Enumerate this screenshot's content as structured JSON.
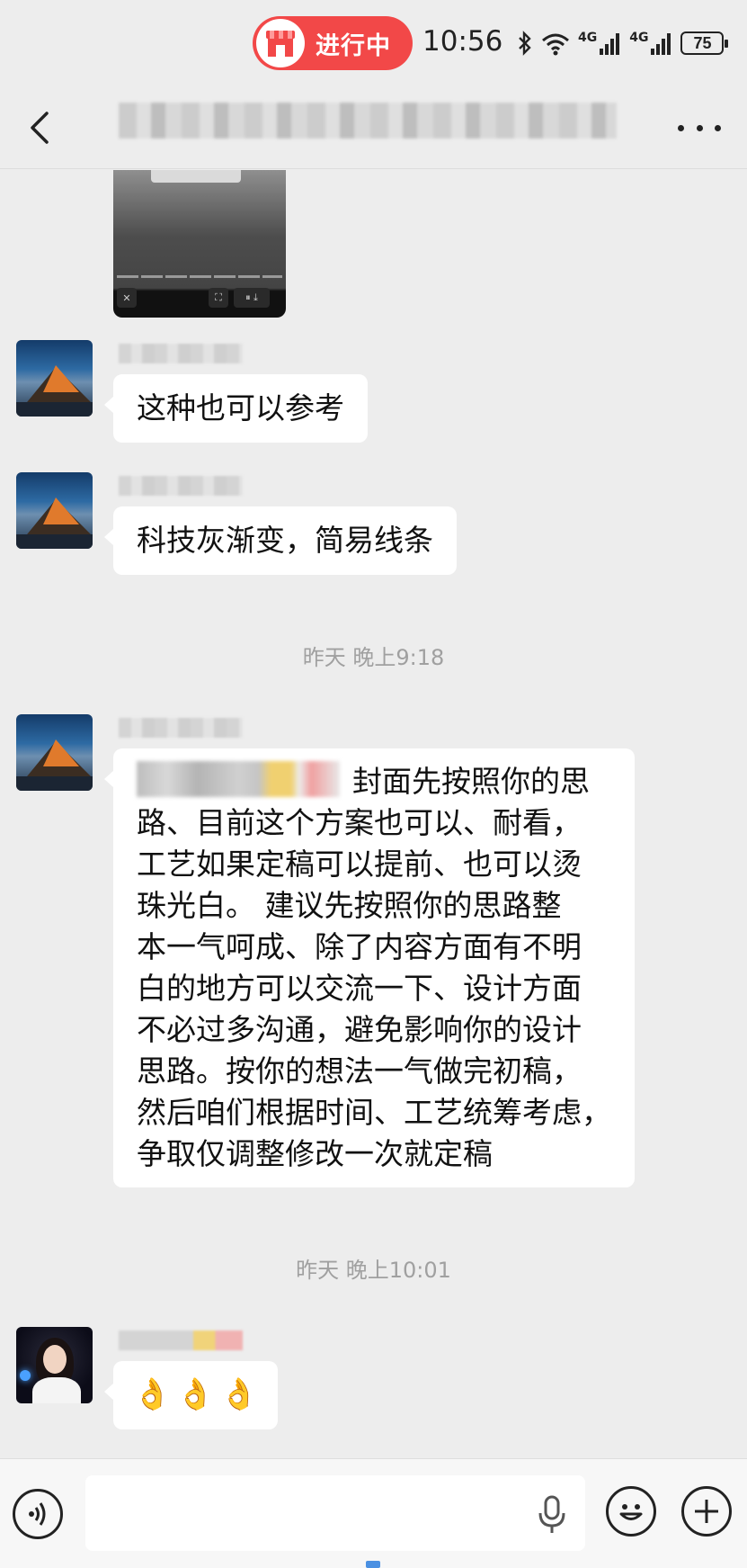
{
  "status_bar": {
    "pill_label": "进行中",
    "time": "10:56",
    "network_1": "4G",
    "network_2": "4G",
    "battery": "75"
  },
  "nav": {
    "back_icon": "chevron-left-icon",
    "more_icon": "more-dots-icon"
  },
  "messages": [
    {
      "type": "text",
      "text": "这种也可以参考"
    },
    {
      "type": "text",
      "text": "科技灰渐变，简易线条"
    },
    {
      "type": "timestamp",
      "text": "昨天 晚上9:18"
    },
    {
      "type": "text",
      "lines": [
        "封面先按照你的思",
        "路、目前这个方案也可以、耐看，",
        "工艺如果定稿可以提前、也可以烫",
        "珠光白。  建议先按照你的思路整",
        "本一气呵成、除了内容方面有不明",
        "白的地方可以交流一下、设计方面",
        "不必过多沟通，避免影响你的设计",
        "思路。按你的想法一气做完初稿，",
        "然后咱们根据时间、工艺统筹考虑，",
        "争取仅调整修改一次就定稿"
      ]
    },
    {
      "type": "timestamp",
      "text": "昨天 晚上10:01"
    },
    {
      "type": "emoji",
      "emojis": [
        "👌",
        "👌",
        "👌"
      ]
    }
  ],
  "input_bar": {
    "voice_icon": "voice-icon",
    "mic_icon": "microphone-icon",
    "emoji_icon": "emoji-icon",
    "plus_icon": "plus-icon",
    "input_value": ""
  },
  "colors": {
    "background": "#ededed",
    "bubble": "#ffffff",
    "pill": "#f24848",
    "timestamp": "#a0a0a0"
  }
}
